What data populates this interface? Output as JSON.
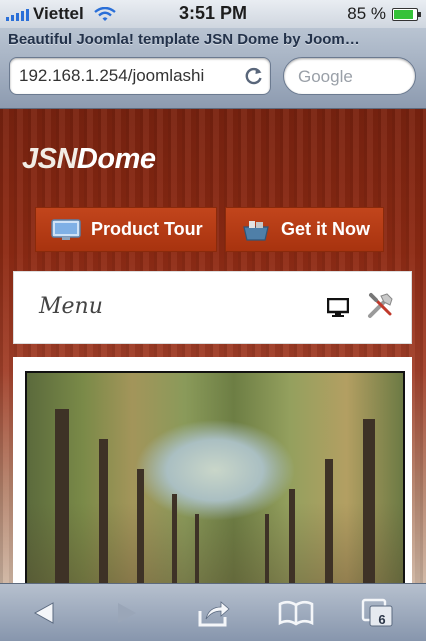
{
  "status_bar": {
    "carrier": "Viettel",
    "time": "3:51 PM",
    "battery_percent": "85 %",
    "battery_level": 0.85
  },
  "browser": {
    "page_title": "Beautiful Joomla! template JSN Dome by Joom…",
    "url": "192.168.1.254/joomlashi",
    "search_placeholder": "Google",
    "tab_count": "6"
  },
  "site": {
    "logo": {
      "prefix": "JSN",
      "name": "Dome"
    },
    "buttons": [
      {
        "label": "Product Tour",
        "icon": "monitor-icon"
      },
      {
        "label": "Get it Now",
        "icon": "basket-icon"
      }
    ],
    "menu_label": "Menu",
    "menu_icons": [
      "monitor-icon",
      "tools-icon"
    ]
  },
  "icons": {
    "back": "back-arrow-icon",
    "forward": "forward-arrow-icon",
    "share": "share-icon",
    "bookmarks": "bookmarks-icon",
    "tabs": "tabs-icon",
    "reload": "reload-icon"
  },
  "colors": {
    "accent": "#b83d16",
    "battery": "#36c23a",
    "signal": "#2a6fd8"
  }
}
